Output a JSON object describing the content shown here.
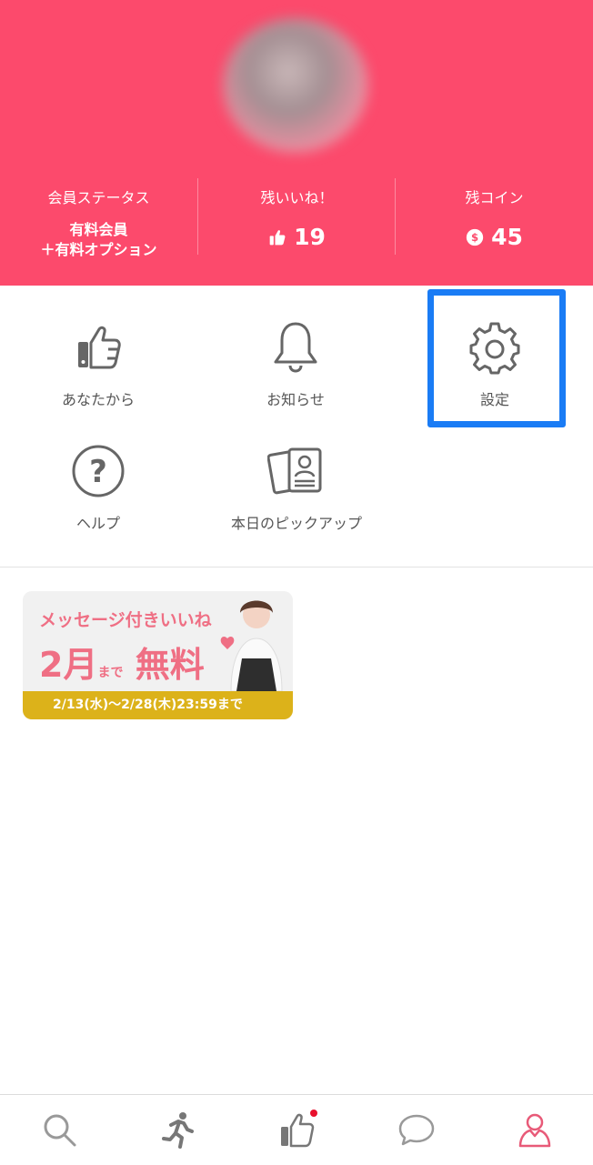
{
  "profile": {
    "stats": {
      "status_label": "会員ステータス",
      "status_line1": "有料会員",
      "status_line2": "＋有料オプション",
      "likes_label": "残いいね！",
      "likes_value": "19",
      "coins_label": "残コイン",
      "coins_value": "45"
    }
  },
  "menu": {
    "items": [
      {
        "label": "あなたから"
      },
      {
        "label": "お知らせ"
      },
      {
        "label": "設定"
      },
      {
        "label": "ヘルプ"
      },
      {
        "label": "本日のピックアップ"
      }
    ]
  },
  "banner": {
    "title": "メッセージ付きいいね",
    "big_part1": "2月",
    "big_small": "まで",
    "big_part2": "無料",
    "period": "2/13(水)〜2/28(木)23:59まで"
  },
  "tabs": [
    {
      "icon": "search-icon"
    },
    {
      "icon": "running-icon"
    },
    {
      "icon": "like-icon",
      "badge": true
    },
    {
      "icon": "chat-icon"
    },
    {
      "icon": "profile-icon",
      "active": true
    }
  ],
  "colors": {
    "header_bg": "#fc4a6c",
    "highlight": "#1a7cf5",
    "banner_accent": "#ef6f84",
    "banner_period_bg": "#dcb21a",
    "active_tab": "#e85a78"
  }
}
